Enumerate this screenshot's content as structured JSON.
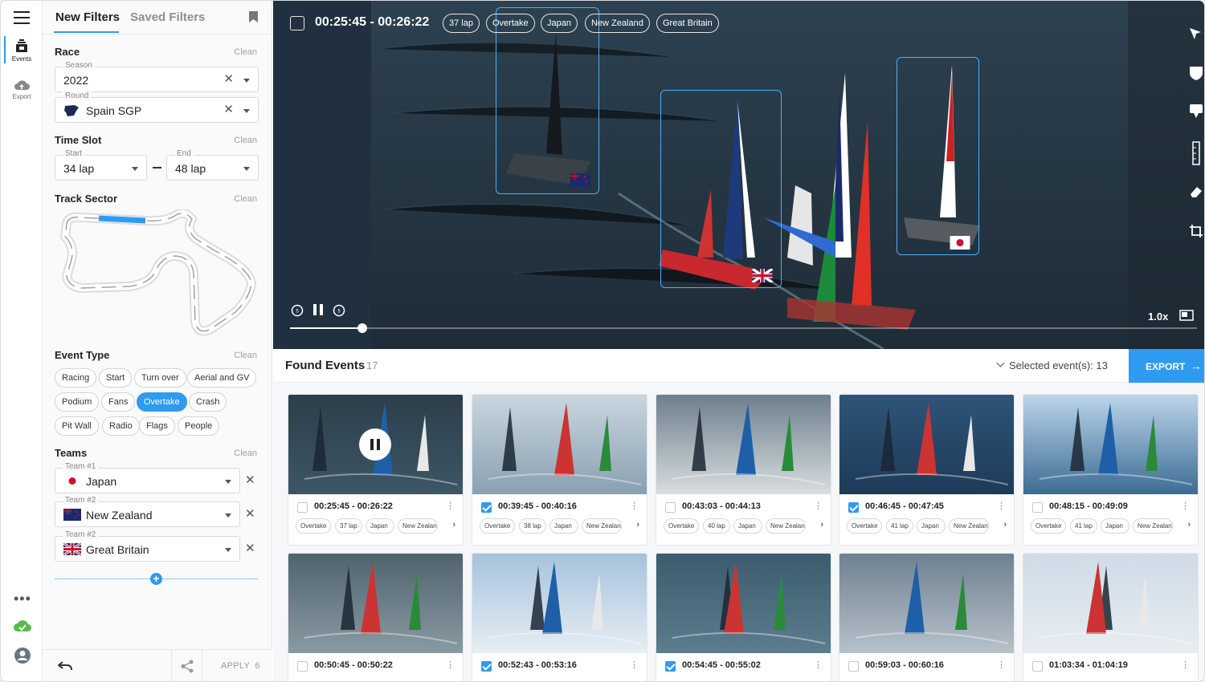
{
  "colors": {
    "accent": "#2f9bf0",
    "rail_active": "#1a1a1a",
    "export_bg": "#2f9bf0"
  },
  "rail": {
    "items": [
      {
        "label": "Events",
        "icon": "events-icon"
      },
      {
        "label": "Export",
        "icon": "cloud-upload-icon"
      }
    ],
    "bottom_icons": [
      "more-dots-icon",
      "cloud-check-icon",
      "user-icon"
    ]
  },
  "filters": {
    "tabs": [
      "New Filters",
      "Saved Filters"
    ],
    "clean_label": "Clean",
    "race": {
      "title": "Race",
      "season_label": "Season",
      "season_value": "2022",
      "round_label": "Round",
      "round_value": "Spain SGP"
    },
    "time_slot": {
      "title": "Time Slot",
      "start_label": "Start",
      "start_value": "34 lap",
      "end_label": "End",
      "end_value": "48 lap"
    },
    "track": {
      "title": "Track Sector"
    },
    "event_type": {
      "title": "Event Type",
      "chips": [
        {
          "label": "Racing",
          "on": false
        },
        {
          "label": "Start",
          "on": false
        },
        {
          "label": "Turn over",
          "on": false
        },
        {
          "label": "Aerial and GV",
          "on": false
        },
        {
          "label": "Podium",
          "on": false
        },
        {
          "label": "Fans",
          "on": false
        },
        {
          "label": "Overtake",
          "on": true
        },
        {
          "label": "Crash",
          "on": false
        },
        {
          "label": "Pit Wall",
          "on": false
        },
        {
          "label": "Radio",
          "on": false
        },
        {
          "label": "Flags",
          "on": false
        },
        {
          "label": "People",
          "on": false
        }
      ]
    },
    "teams": {
      "title": "Teams",
      "rows": [
        {
          "label": "Team #1",
          "value": "Japan",
          "flag": "jp"
        },
        {
          "label": "Team #2",
          "value": "New Zealand",
          "flag": "nz"
        },
        {
          "label": "Team #2",
          "value": "Great Britain",
          "flag": "gb"
        }
      ]
    },
    "footer": {
      "apply_label": "APPLY",
      "apply_count": "6"
    }
  },
  "video": {
    "time_range": "00:25:45 - 00:26:22",
    "tags": [
      "37 lap",
      "Overtake",
      "Japan",
      "New Zealand",
      "Great Britain"
    ],
    "speed": "1.0x",
    "progress": 0.08
  },
  "found": {
    "title": "Found Events",
    "count": "17",
    "selected_text": "Selected event(s): 13",
    "export_label": "EXPORT"
  },
  "cards": [
    {
      "time": "00:25:45 - 00:26:22",
      "checked": false,
      "tags": [
        "Overtake",
        "37 lap",
        "Japan",
        "New Zealand"
      ],
      "playing": true
    },
    {
      "time": "00:39:45 - 00:40:16",
      "checked": true,
      "tags": [
        "Overtake",
        "38 lap",
        "Japan",
        "New Zealand"
      ]
    },
    {
      "time": "00:43:03 - 00:44:13",
      "checked": false,
      "tags": [
        "Overtake",
        "40 lap",
        "Japan",
        "New Zealand"
      ]
    },
    {
      "time": "00:46:45 - 00:47:45",
      "checked": true,
      "tags": [
        "Overtake",
        "41 lap",
        "Japan",
        "New Zealand"
      ]
    },
    {
      "time": "00:48:15 - 00:49:09",
      "checked": false,
      "tags": [
        "Overtake",
        "41 lap",
        "Japan",
        "New Zealand"
      ]
    },
    {
      "time": "00:50:45 - 00:50:22",
      "checked": false,
      "tags": []
    },
    {
      "time": "00:52:43 - 00:53:16",
      "checked": true,
      "tags": []
    },
    {
      "time": "00:54:45 - 00:55:02",
      "checked": true,
      "tags": []
    },
    {
      "time": "00:59:03 - 00:60:16",
      "checked": false,
      "tags": []
    },
    {
      "time": "01:03:34 - 01:04:19",
      "checked": false,
      "tags": []
    }
  ]
}
